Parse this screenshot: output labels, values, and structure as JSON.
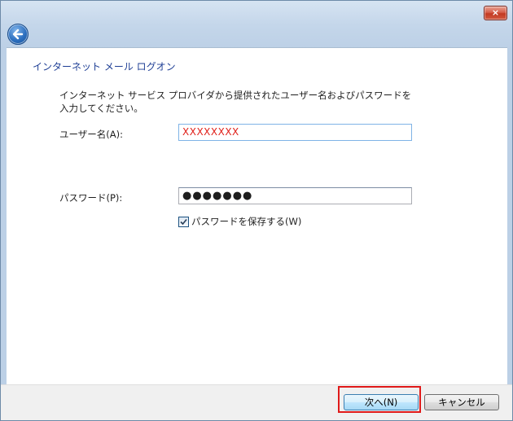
{
  "window": {
    "close_label": "×"
  },
  "page": {
    "title": "インターネット メール ログオン",
    "instructions": "インターネット サービス プロバイダから提供されたユーザー名およびパスワードを入力してください。"
  },
  "form": {
    "username_label": "ユーザー名(A):",
    "username_value": "XXXXXXXX",
    "password_label": "パスワード(P):",
    "password_value": "●●●●●●●",
    "remember_label": "パスワードを保存する(W)",
    "remember_checked": true
  },
  "buttons": {
    "next_label": "次へ(N)",
    "cancel_label": "キャンセル"
  },
  "colors": {
    "title_blue": "#1f3f95",
    "username_text": "#e0201a",
    "highlight_red": "#e01a1a"
  }
}
